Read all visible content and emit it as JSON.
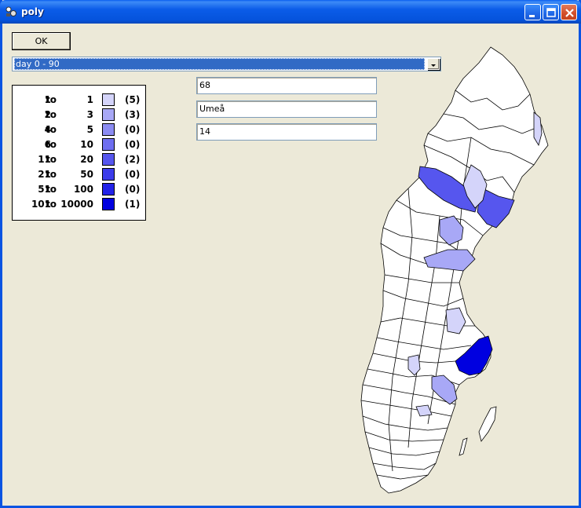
{
  "window": {
    "title": "poly",
    "colors": {
      "titlebar": "#0A5FEF",
      "face": "#ECE9D8",
      "selection": "#316AC5"
    }
  },
  "toolbar": {
    "ok_label": "OK"
  },
  "period_select": {
    "selected": "day  0 - 90"
  },
  "legend": {
    "rows": [
      {
        "from": "1",
        "to_word": "to",
        "upto": "1",
        "count": "(5)",
        "color": "#D4D4FA"
      },
      {
        "from": "2",
        "to_word": "to",
        "upto": "3",
        "count": "(3)",
        "color": "#A8A8F6"
      },
      {
        "from": "4",
        "to_word": "to",
        "upto": "5",
        "count": "(0)",
        "color": "#8C8CF3"
      },
      {
        "from": "6",
        "to_word": "to",
        "upto": "10",
        "count": "(0)",
        "color": "#6E6EF0"
      },
      {
        "from": "11",
        "to_word": "to",
        "upto": "20",
        "count": "(2)",
        "color": "#5656EE"
      },
      {
        "from": "21",
        "to_word": "to",
        "upto": "50",
        "count": "(0)",
        "color": "#3C3CEB"
      },
      {
        "from": "51",
        "to_word": "to",
        "upto": "100",
        "count": "(0)",
        "color": "#2222E8"
      },
      {
        "from": "101",
        "to_word": "to",
        "upto": "10000",
        "count": "(1)",
        "color": "#0000E0"
      }
    ]
  },
  "fields": {
    "code": "68",
    "region": "Umeå",
    "value": "14"
  },
  "map": {
    "region_colors": {
      "none": "#FFFFFF",
      "low": "#D4D4FA",
      "mid": "#A8A8F6",
      "high": "#5656EE",
      "top": "#0000E0"
    }
  }
}
